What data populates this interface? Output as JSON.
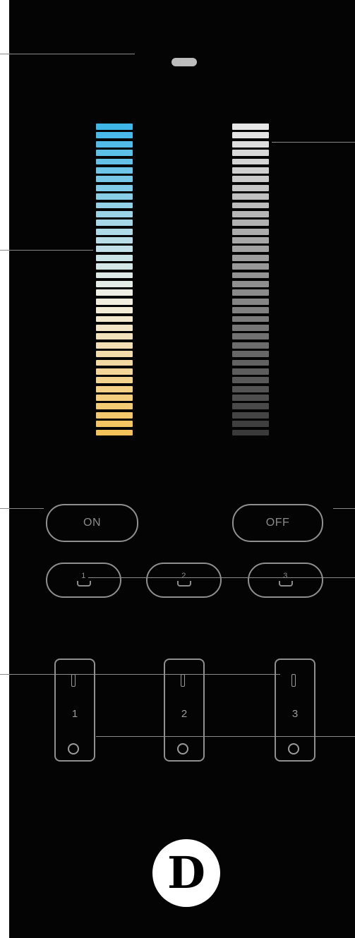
{
  "buttons": {
    "on_label": "ON",
    "off_label": "OFF"
  },
  "presets": [
    "1",
    "2",
    "3"
  ],
  "zones": [
    "1",
    "2",
    "3"
  ],
  "logo": {
    "letter": "D"
  },
  "colors": {
    "body": "#040404",
    "outline": "#8f8f8f",
    "led": "#bdbdbd",
    "cct_cool": "#3fb6e8",
    "cct_neutral": "#f2f0e6",
    "cct_warm": "#f3c25a",
    "dim_high": "#e8e8e8",
    "dim_low": "#3a3a3a"
  },
  "sliders": {
    "color_temperature": {
      "segments": 36
    },
    "brightness": {
      "segments": 36
    }
  }
}
